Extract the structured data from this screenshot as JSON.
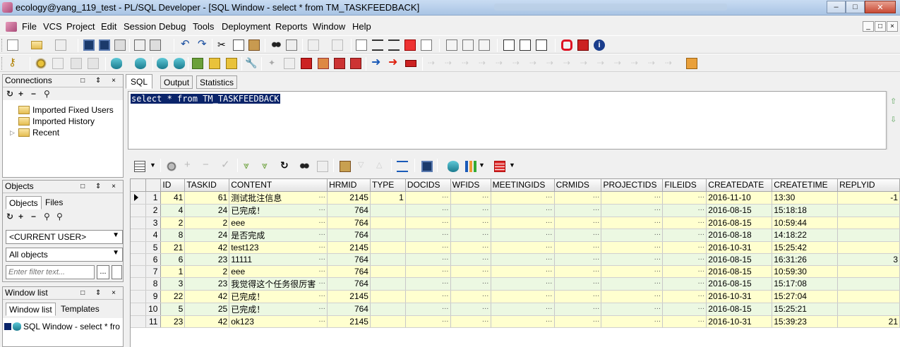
{
  "window": {
    "title": "ecology@yang_119_test - PL/SQL Developer - [SQL Window - select * from TM_TASKFEEDBACK]",
    "min": "–",
    "max": "□",
    "close": "✕"
  },
  "menu": [
    "File",
    "VCS",
    "Project",
    "Edit",
    "Session",
    "Debug",
    "Tools",
    "Deployment",
    "Reports",
    "Window",
    "Help"
  ],
  "mdi": [
    "_",
    "□",
    "×"
  ],
  "connections": {
    "title": "Connections",
    "controls": "□ ⇕ ×",
    "tools": [
      "↻",
      "+",
      "−",
      "⚲"
    ],
    "items": [
      {
        "label": "Imported Fixed Users",
        "expander": ""
      },
      {
        "label": "Imported History",
        "expander": ""
      },
      {
        "label": "Recent",
        "expander": "▷"
      }
    ]
  },
  "objects": {
    "title": "Objects",
    "controls": "□ ⇕ ×",
    "tabs": [
      "Objects",
      "Files"
    ],
    "tools": [
      "↻",
      "+",
      "−",
      "⚲",
      "⚲"
    ],
    "user_combo": "<CURRENT USER>",
    "scope_combo": "All objects",
    "filter_placeholder": "Enter filter text...",
    "browse": "..."
  },
  "windowlist": {
    "title": "Window list",
    "controls": "□ ⇕ ×",
    "tabs": [
      "Window list",
      "Templates"
    ],
    "item": "SQL Window - select * fro"
  },
  "sqltabs": [
    "SQL",
    "Output",
    "Statistics"
  ],
  "editor": {
    "sql": "select * from TM_TASKFEEDBACK"
  },
  "grid": {
    "columns": [
      "ID",
      "TASKID",
      "CONTENT",
      "HRMID",
      "TYPE",
      "DOCIDS",
      "WFIDS",
      "MEETINGIDS",
      "CRMIDS",
      "PROJECTIDS",
      "FILEIDS",
      "CREATEDATE",
      "CREATETIME",
      "REPLYID"
    ],
    "rows": [
      {
        "n": "1",
        "id": "41",
        "taskid": "61",
        "content": "测试批注信息",
        "hrmid": "2145",
        "type": "1",
        "date": "2016-11-10",
        "time": "13:30",
        "reply": "-1"
      },
      {
        "n": "2",
        "id": "4",
        "taskid": "24",
        "content": "已完成！",
        "hrmid": "764",
        "type": "",
        "date": "2016-08-15",
        "time": "15:18:18",
        "reply": ""
      },
      {
        "n": "3",
        "id": "2",
        "taskid": "2",
        "content": "eee",
        "hrmid": "764",
        "type": "",
        "date": "2016-08-15",
        "time": "10:59:44",
        "reply": ""
      },
      {
        "n": "4",
        "id": "8",
        "taskid": "24",
        "content": "是否完成",
        "hrmid": "764",
        "type": "",
        "date": "2016-08-18",
        "time": "14:18:22",
        "reply": ""
      },
      {
        "n": "5",
        "id": "21",
        "taskid": "42",
        "content": "test123",
        "hrmid": "2145",
        "type": "",
        "date": "2016-10-31",
        "time": "15:25:42",
        "reply": ""
      },
      {
        "n": "6",
        "id": "6",
        "taskid": "23",
        "content": "11111",
        "hrmid": "764",
        "type": "",
        "date": "2016-08-15",
        "time": "16:31:26",
        "reply": "3"
      },
      {
        "n": "7",
        "id": "1",
        "taskid": "2",
        "content": "eee",
        "hrmid": "764",
        "type": "",
        "date": "2016-08-15",
        "time": "10:59:30",
        "reply": ""
      },
      {
        "n": "8",
        "id": "3",
        "taskid": "23",
        "content": "我觉得这个任务很厉害",
        "hrmid": "764",
        "type": "",
        "date": "2016-08-15",
        "time": "15:17:08",
        "reply": ""
      },
      {
        "n": "9",
        "id": "22",
        "taskid": "42",
        "content": "已完成！",
        "hrmid": "2145",
        "type": "",
        "date": "2016-10-31",
        "time": "15:27:04",
        "reply": ""
      },
      {
        "n": "10",
        "id": "5",
        "taskid": "25",
        "content": "已完成！",
        "hrmid": "764",
        "type": "",
        "date": "2016-08-15",
        "time": "15:25:21",
        "reply": ""
      },
      {
        "n": "11",
        "id": "23",
        "taskid": "42",
        "content": "ok123",
        "hrmid": "2145",
        "type": "",
        "date": "2016-10-31",
        "time": "15:39:23",
        "reply": "21"
      }
    ]
  },
  "colors": {
    "selection": "#0a246a",
    "row_even": "#ecf8e2",
    "row_odd": "#ffffcf"
  }
}
